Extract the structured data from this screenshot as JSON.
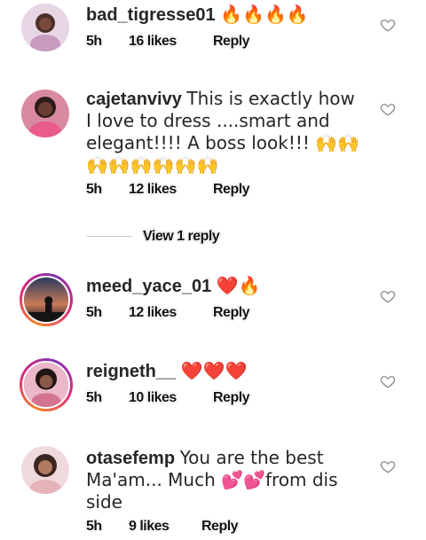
{
  "comments": [
    {
      "username": "bad_tigresse01",
      "text": "🔥🔥🔥🔥",
      "time": "5h",
      "likes": "16 likes",
      "reply_label": "Reply"
    },
    {
      "username": "cajetanvivy",
      "text": "This is exactly how I love to dress ....smart and elegant!!!! A boss look!!! 🙌🙌🙌🙌🙌🙌🙌🙌",
      "time": "5h",
      "likes": "12 likes",
      "reply_label": "Reply",
      "view_replies": "View 1 reply"
    },
    {
      "username": "meed_yace_01",
      "text": "❤️🔥",
      "time": "5h",
      "likes": "12 likes",
      "reply_label": "Reply"
    },
    {
      "username": "reigneth__",
      "text": "❤️❤️❤️",
      "time": "5h",
      "likes": "10 likes",
      "reply_label": "Reply"
    },
    {
      "username": "otasefemp",
      "text": "You are the best Ma'am... Much 💕💕from dis side",
      "time": "5h",
      "likes": "9 likes",
      "reply_label": "Reply"
    }
  ],
  "icons": {
    "like": "heart-outline-icon"
  },
  "colors": {
    "text": "#262626",
    "muted": "#c7c7c7",
    "ring_start": "#f58529",
    "ring_end": "#dd2a7b"
  }
}
